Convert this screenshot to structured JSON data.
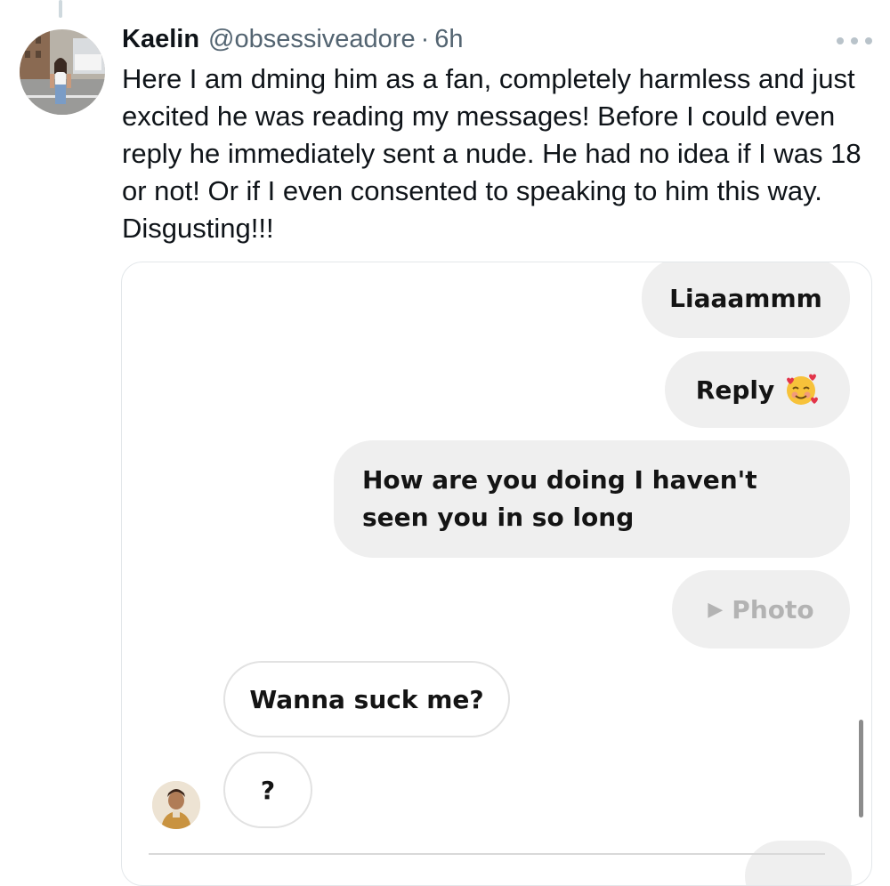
{
  "tweet": {
    "display_name": "Kaelin",
    "handle": "@obsessiveadore",
    "separator": "·",
    "time": "6h",
    "more_icon": "more-horizontal-icon",
    "text": "Here I am dming him as a fan, completely harmless and just excited he was reading my messages! Before I could even reply he immediately sent a nude. He had no idea if I was 18 or not! Or if I even consented to speaking to him this way. Disgusting!!!"
  },
  "dm": {
    "messages": [
      {
        "direction": "sent",
        "text": "Liaaammm"
      },
      {
        "direction": "sent",
        "text": "Reply",
        "emoji": "smiling-face-with-hearts"
      },
      {
        "direction": "sent",
        "text": "How are you doing I haven't seen you in so long"
      },
      {
        "direction": "sent",
        "text": "Photo",
        "icon": "play-icon"
      },
      {
        "direction": "received",
        "text": "Wanna suck me?"
      },
      {
        "direction": "received",
        "text": "?"
      }
    ]
  },
  "colors": {
    "name": "#0f1419",
    "muted": "#536471",
    "sent_bubble": "#efefef",
    "received_border": "#e2e2e2",
    "photo_text": "#b3b3b3"
  }
}
